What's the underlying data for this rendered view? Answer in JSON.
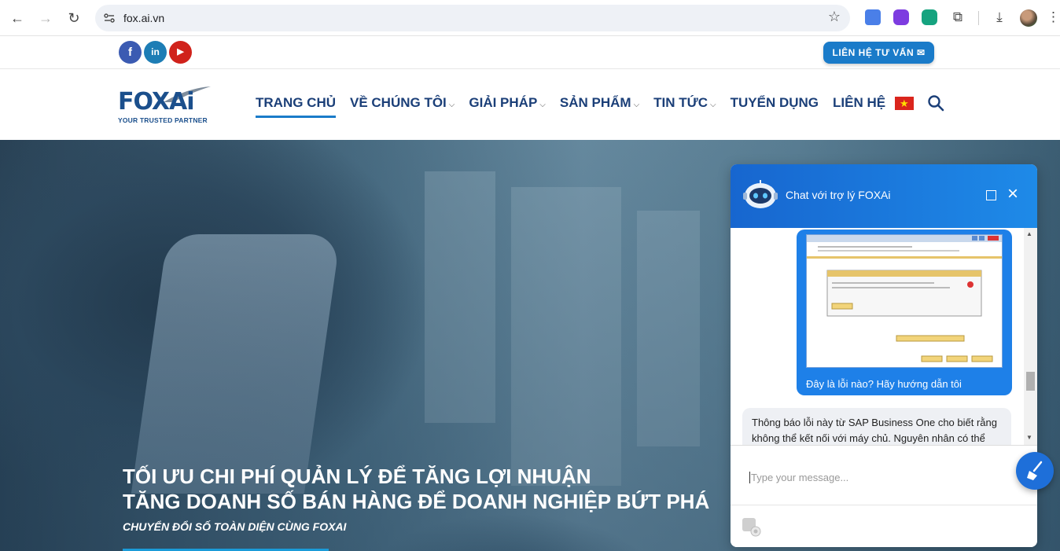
{
  "browser": {
    "url": "fox.ai.vn",
    "icons": [
      "back-icon",
      "forward-icon",
      "reload-icon",
      "site-info-icon",
      "bookmark-star-icon",
      "translate-icon",
      "extension-icon",
      "puzzle-icon",
      "download-icon",
      "menu-icon"
    ],
    "back": "←",
    "forward": "→",
    "reload": "↻",
    "star": "☆",
    "puzzle": "⧉",
    "download": "⤓",
    "kebab": "⋮"
  },
  "topbar": {
    "social": {
      "facebook": "f",
      "linkedin": "in",
      "youtube": "▶"
    },
    "contact_button": "LIÊN HỆ TƯ VẤN ✉"
  },
  "header": {
    "logo": {
      "wordmark": "FOXAi",
      "tagline": "YOUR TRUSTED PARTNER"
    },
    "menu": [
      {
        "label": "TRANG CHỦ",
        "active": true,
        "dropdown": false
      },
      {
        "label": "VỀ CHÚNG TÔI",
        "active": false,
        "dropdown": true
      },
      {
        "label": "GIẢI PHÁP",
        "active": false,
        "dropdown": true
      },
      {
        "label": "SẢN PHẨM",
        "active": false,
        "dropdown": true
      },
      {
        "label": "TIN TỨC",
        "active": false,
        "dropdown": true
      },
      {
        "label": "TUYỂN DỤNG",
        "active": false,
        "dropdown": false
      },
      {
        "label": "LIÊN HỆ",
        "active": false,
        "dropdown": false
      }
    ],
    "caret": "⌵",
    "flag_star": "★"
  },
  "hero": {
    "title_line1": "TỐI ƯU CHI PHÍ QUẢN LÝ ĐỂ TĂNG LỢI NHUẬN",
    "title_line2": "TĂNG DOANH SỐ BÁN HÀNG ĐỂ DOANH NGHIỆP BỨT PHÁ",
    "subtitle": "CHUYỂN ĐỔI SỐ TOÀN DIỆN CÙNG FOXAI"
  },
  "chat": {
    "title": "Chat với trợ lý FOXAi",
    "close": "×",
    "user_message": "Đây là lỗi nào? Hãy hướng dẫn tôi",
    "bot_message": "Thông báo lỗi này từ SAP Business One cho biết rằng không thể kết nối với máy chủ. Nguyên nhân có thể",
    "input_placeholder": "Type your message...",
    "scroll_up": "▲",
    "scroll_down": "▼"
  },
  "colors": {
    "brand_blue": "#1b4f8c",
    "accent_blue": "#1a7bc9",
    "chat_header": "#1766cf"
  }
}
